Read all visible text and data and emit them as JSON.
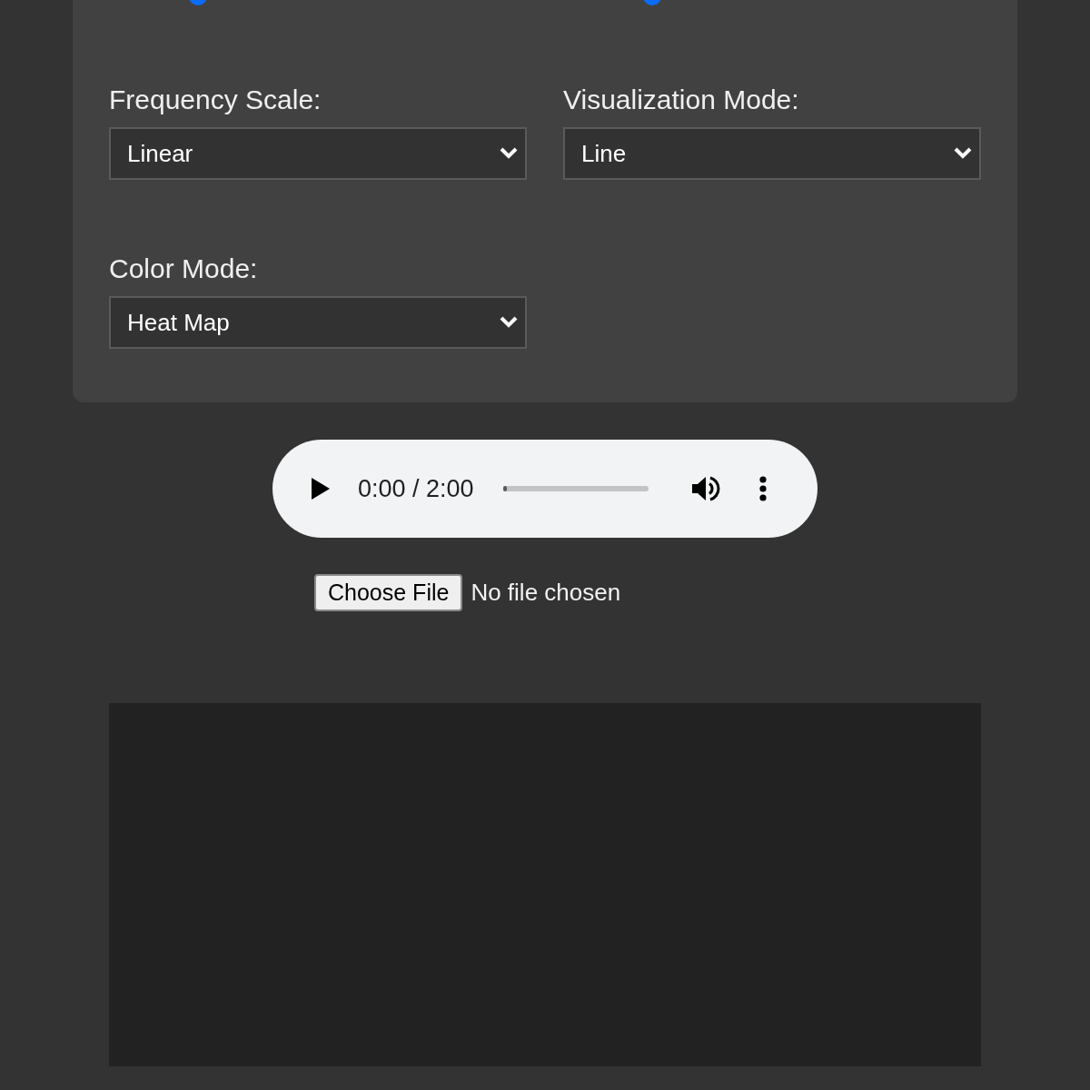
{
  "sliders": [
    {
      "level": 0.2
    },
    {
      "level": 0.2
    }
  ],
  "controls": [
    {
      "label": "Frequency Scale:",
      "value": "Linear"
    },
    {
      "label": "Visualization Mode:",
      "value": "Line"
    },
    {
      "label": "Color Mode:",
      "value": "Heat Map"
    }
  ],
  "audio_player": {
    "time": "0:00 / 2:00",
    "level": 0
  },
  "file_input": {
    "button": "Choose File",
    "status": "No file chosen"
  }
}
